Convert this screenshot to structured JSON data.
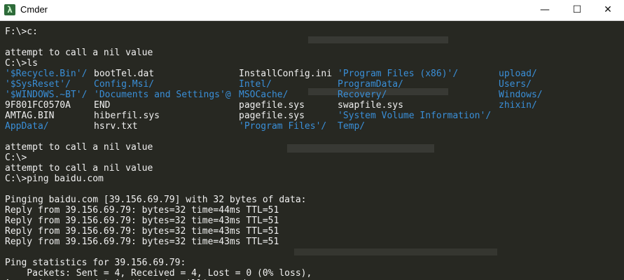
{
  "window": {
    "title": "Cmder",
    "app_icon": "λ",
    "min_label": "—",
    "max_label": "☐",
    "close_label": "✕"
  },
  "colors": {
    "terminal_bg": "#272822",
    "text": "#f0f0f0",
    "dir": "#3a8fd8"
  },
  "lines_a": [
    "F:\\>c:",
    "",
    "attempt to call a nil value",
    "C:\\>ls"
  ],
  "ls": [
    [
      {
        "t": "'$Recycle.Bin'/",
        "d": true
      },
      {
        "t": "bootTel.dat",
        "d": false
      },
      {
        "t": "InstallConfig.ini",
        "d": false
      },
      {
        "t": "'Program Files (x86)'/",
        "d": true
      },
      {
        "t": "upload/",
        "d": true
      }
    ],
    [
      {
        "t": "'$SysReset'/",
        "d": true
      },
      {
        "t": "Config.Msi/",
        "d": true
      },
      {
        "t": "Intel/",
        "d": true
      },
      {
        "t": "ProgramData/",
        "d": true
      },
      {
        "t": "Users/",
        "d": true
      }
    ],
    [
      {
        "t": "'$WINDOWS.~BT'/",
        "d": true
      },
      {
        "t": "'Documents and Settings'@",
        "d": true
      },
      {
        "t": "MSOCache/",
        "d": true
      },
      {
        "t": "Recovery/",
        "d": true
      },
      {
        "t": "Windows/",
        "d": true
      }
    ],
    [
      {
        "t": "9F801FC0570A",
        "d": false
      },
      {
        "t": "END",
        "d": false
      },
      {
        "t": "pagefile.sys",
        "d": false
      },
      {
        "t": "swapfile.sys",
        "d": false
      },
      {
        "t": "zhixin/",
        "d": true
      }
    ],
    [
      {
        "t": "AMTAG.BIN",
        "d": false
      },
      {
        "t": "hiberfil.sys",
        "d": false
      },
      {
        "t": "pagefile.sys",
        "d": false
      },
      {
        "t": "'System Volume Information'/",
        "d": true
      },
      {
        "t": "",
        "d": false
      }
    ],
    [
      {
        "t": "AppData/",
        "d": true
      },
      {
        "t": "hsrv.txt",
        "d": false
      },
      {
        "t": "'Program Files'/",
        "d": true
      },
      {
        "t": "Temp/",
        "d": true
      },
      {
        "t": "",
        "d": false
      }
    ]
  ],
  "lines_b": [
    "",
    "attempt to call a nil value",
    "C:\\>",
    "attempt to call a nil value",
    "C:\\>ping baidu.com",
    "",
    "Pinging baidu.com [39.156.69.79] with 32 bytes of data:",
    "Reply from 39.156.69.79: bytes=32 time=44ms TTL=51",
    "Reply from 39.156.69.79: bytes=32 time=43ms TTL=51",
    "Reply from 39.156.69.79: bytes=32 time=43ms TTL=51",
    "Reply from 39.156.69.79: bytes=32 time=43ms TTL=51",
    "",
    "Ping statistics for 39.156.69.79:",
    "    Packets: Sent = 4, Received = 4, Lost = 0 (0% loss),",
    "Approximate round trip times in milli-seconds:"
  ]
}
